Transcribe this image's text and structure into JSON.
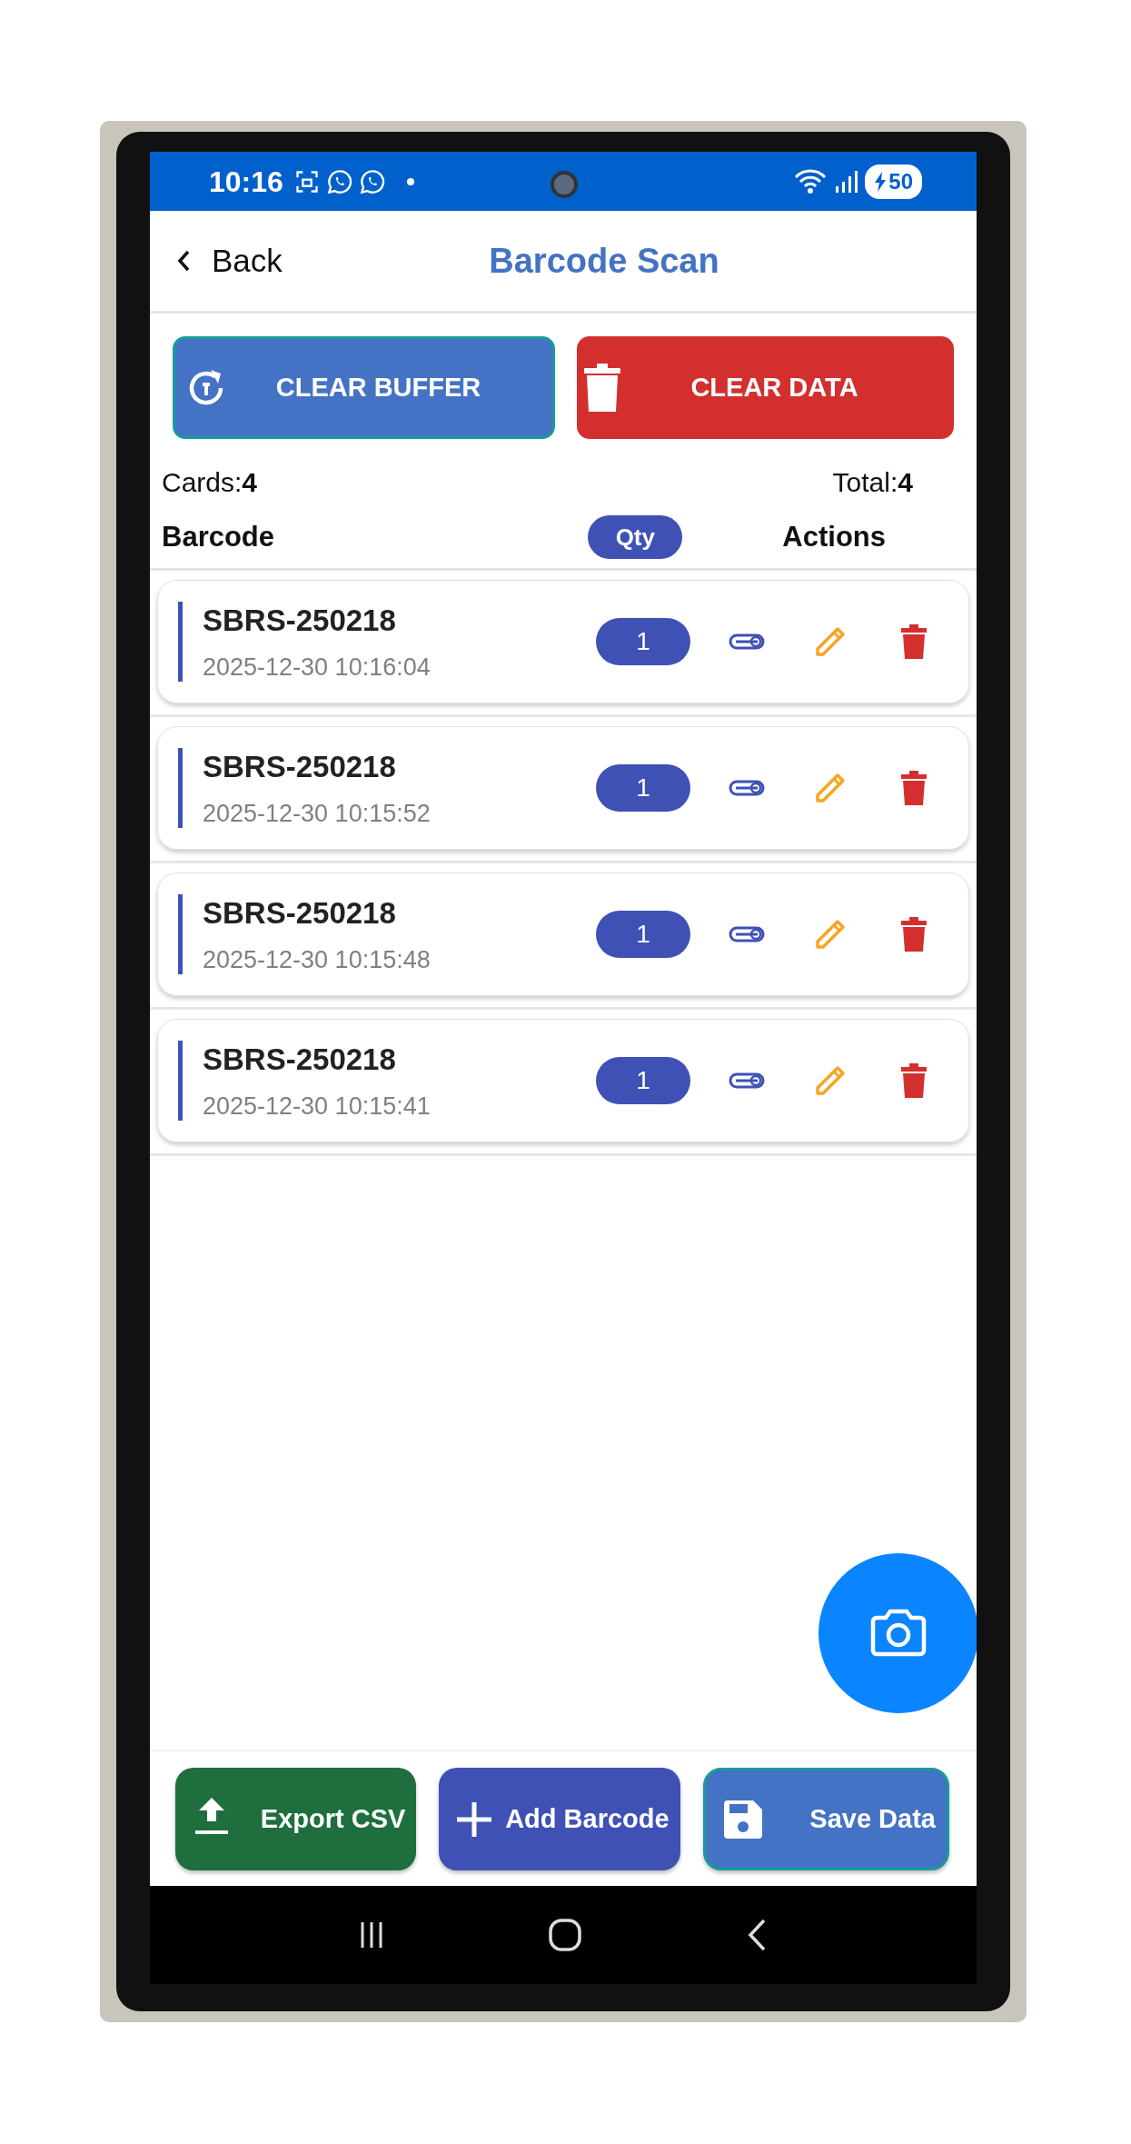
{
  "status_bar": {
    "time": "10:16",
    "battery": "50"
  },
  "header": {
    "back": "Back",
    "title": "Barcode Scan"
  },
  "actions": [
    {
      "label": "CLEAR BUFFER",
      "kind": "refresh"
    },
    {
      "label": "CLEAR DATA",
      "kind": "trash"
    }
  ],
  "summary": {
    "cards": "Cards:**4**",
    "total": "Total:**4**"
  },
  "columns": [
    "Barcode",
    "Qty",
    "Actions"
  ],
  "rows": [
    {
      "barcode": "SBRS-250218",
      "time": "2025-12-30 10:16:04",
      "qty": "1"
    },
    {
      "barcode": "SBRS-250218",
      "time": "2025-12-30 10:15:52",
      "qty": "1"
    },
    {
      "barcode": "SBRS-250218",
      "time": "2025-12-30 10:15:48",
      "qty": "1"
    },
    {
      "barcode": "SBRS-250218",
      "time": "2025-12-30 10:15:41",
      "qty": "1"
    }
  ],
  "bottom_buttons": [
    {
      "label": "Export CSV",
      "kind": "export"
    },
    {
      "label": "Add Barcode",
      "kind": "add"
    },
    {
      "label": "Save Data",
      "kind": "save"
    }
  ]
}
